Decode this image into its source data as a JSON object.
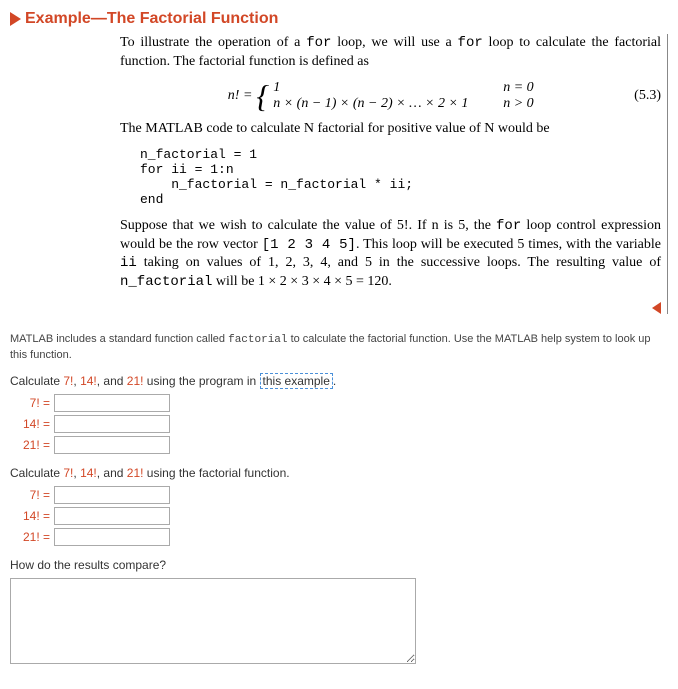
{
  "header": {
    "title": "Example—The Factorial Function"
  },
  "paragraphs": {
    "intro_a": "To illustrate the operation of a ",
    "intro_b": " loop, we will use a ",
    "intro_c": " loop to calculate the factorial function. The factorial function is defined as",
    "for_kw": "for",
    "matlab_line": "The MATLAB code to calculate N factorial for positive value of N would be",
    "suppose_a": "Suppose that we wish to calculate the value of 5!. If n is 5, the ",
    "suppose_b": " loop control expression would be the row vector ",
    "suppose_vec": "[1  2  3  4  5]",
    "suppose_c": ". This loop will be executed 5 times, with the variable ",
    "suppose_ii": "ii",
    "suppose_d": " taking on values of 1, 2, 3, 4, and 5 in the successive loops. The resulting value of ",
    "suppose_nf": "n_factorial",
    "suppose_e": " will be 1 × 2 × 3 × 4 × 5 = 120."
  },
  "equation": {
    "lhs": "n! = ",
    "case1_expr": "1",
    "case1_cond": "n = 0",
    "case2_expr": "n × (n − 1) × (n − 2) × … × 2 × 1",
    "case2_cond": "n > 0",
    "number": "(5.3)"
  },
  "code": "n_factorial = 1\nfor ii = 1:n\n    n_factorial = n_factorial * ii;\nend",
  "hint": {
    "a": "MATLAB includes a standard function called ",
    "fn": "factorial",
    "b": " to calculate the factorial function. Use the MATLAB help system to look up this function."
  },
  "q1": {
    "prompt_a": "Calculate ",
    "v7": "7!",
    "sep1": ", ",
    "v14": "14!",
    "sep2": ", and ",
    "v21": "21!",
    "prompt_b": " using the program in ",
    "link": "this example",
    "prompt_c": ".",
    "l7": "7! =",
    "l14": "14! =",
    "l21": "21! ="
  },
  "q2": {
    "prompt_a": "Calculate ",
    "v7": "7!",
    "sep1": ", ",
    "v14": "14!",
    "sep2": ", and ",
    "v21": "21!",
    "prompt_b": " using the ",
    "fn": "factorial",
    "prompt_c": " function.",
    "l7": "7! =",
    "l14": "14! =",
    "l21": "21! ="
  },
  "q3": {
    "prompt": "How do the results compare?"
  }
}
